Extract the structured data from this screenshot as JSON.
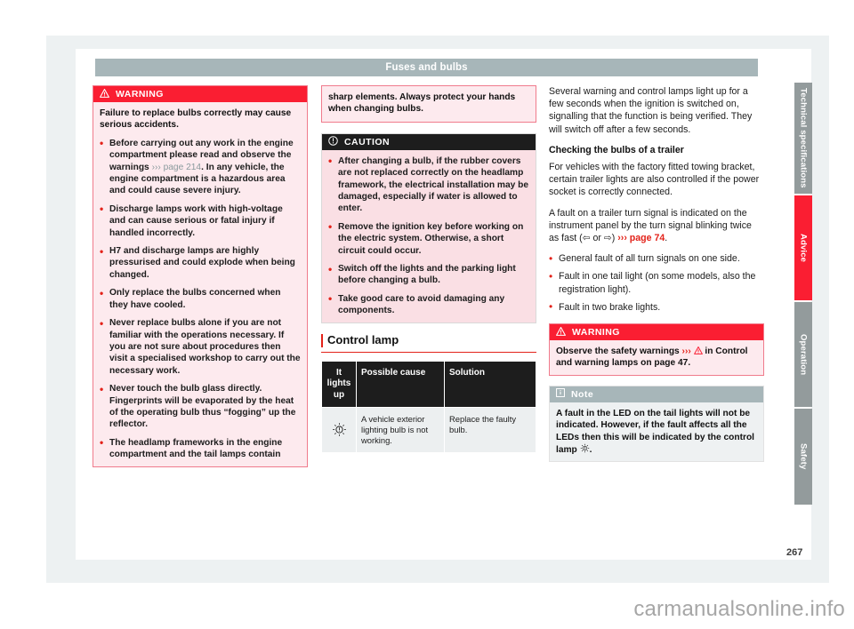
{
  "header": {
    "title": "Fuses and bulbs"
  },
  "page_number": "267",
  "watermark": "carmanualsonline.info",
  "sidebar": {
    "tabs": [
      {
        "label": "Technical specifications",
        "active": false
      },
      {
        "label": "Advice",
        "active": true
      },
      {
        "label": "Operation",
        "active": false
      },
      {
        "label": "Safety",
        "active": false
      }
    ],
    "active_color": "#fa1e32",
    "inactive_color": "#939b9c"
  },
  "column1": {
    "warning_box": {
      "icon": "warning-triangle-icon",
      "title": "WARNING",
      "intro": "Failure to replace bulbs correctly may cause serious accidents.",
      "bullets": [
        {
          "text_before": "Before carrying out any work in the engine compartment please read and observe the warnings ",
          "xref_arrows": "›››",
          "xref": " page 214",
          "text_after": ". In any vehicle, the engine compartment is a hazardous area and could cause severe injury."
        },
        {
          "text": "Discharge lamps work with high-voltage and can cause serious or fatal injury if handled incorrectly."
        },
        {
          "text": "H7 and discharge lamps are highly pressurised and could explode when being changed."
        },
        {
          "text": "Only replace the bulbs concerned when they have cooled."
        },
        {
          "text": "Never replace bulbs alone if you are not familiar with the operations necessary. If you are not sure about procedures then visit a specialised workshop to carry out the necessary work."
        },
        {
          "text": "Never touch the bulb glass directly. Fingerprints will be evaporated by the heat of the operating bulb thus “fogging” up the reflector."
        },
        {
          "text": "The headlamp frameworks in the engine compartment and the tail lamps contain"
        }
      ]
    }
  },
  "column2": {
    "warning_continued": "sharp elements. Always protect your hands when changing bulbs.",
    "caution_box": {
      "icon": "caution-exclamation-icon",
      "title": "CAUTION",
      "bullets": [
        "After changing a bulb, if the rubber covers are not replaced correctly on the headlamp framework, the electrical installation may be damaged, especially if water is allowed to enter.",
        "Remove the ignition key before working on the electric system. Otherwise, a short circuit could occur.",
        "Switch off the lights and the parking light before changing a bulb.",
        "Take good care to avoid damaging any components."
      ]
    },
    "section_heading": "Control lamp",
    "table": {
      "headers": [
        "It lights up",
        "Possible cause",
        "Solution"
      ],
      "rows": [
        {
          "icon": "bulb-failure-lamp-icon",
          "icon_glyph": "☼",
          "cause": "A vehicle exterior lighting bulb is not working.",
          "solution": "Replace the faulty bulb."
        }
      ]
    }
  },
  "column3": {
    "intro": "Several warning and control lamps light up for a few seconds when the ignition is switched on, signalling that the function is being verified. They will switch off after a few seconds.",
    "heading": "Checking the bulbs of a trailer",
    "para1": "For vehicles with the factory fitted towing bracket, certain trailer lights are also controlled if the power socket is correctly connected.",
    "para2_before": "A fault on a trailer turn signal is indicated on the instrument panel by the turn signal blinking twice as fast (",
    "para2_arrow_left": "⇦",
    "para2_or": " or ",
    "para2_arrow_right": "⇨",
    "para2_mid": ") ",
    "para2_xref_arrows": "›››",
    "para2_xref": " page 74",
    "para2_after": ".",
    "bullets": [
      "General fault of all turn signals on one side.",
      "Fault in one tail light (on some models, also the registration light).",
      "Fault in two brake lights."
    ],
    "warning_box": {
      "icon": "warning-triangle-icon",
      "title": "WARNING",
      "text_before": "Observe the safety warnings ",
      "xref_arrows": "›››",
      "tri_glyph": "⚠",
      "text_after": " in Control and warning lamps on page 47."
    },
    "note_box": {
      "icon": "info-note-icon",
      "title": "Note",
      "text_before": "A fault in the LED on the tail lights will not be indicated. However, if the fault affects all the LEDs then this will be indicated by the control lamp ",
      "lamp_glyph": "☼",
      "text_after": "."
    }
  }
}
